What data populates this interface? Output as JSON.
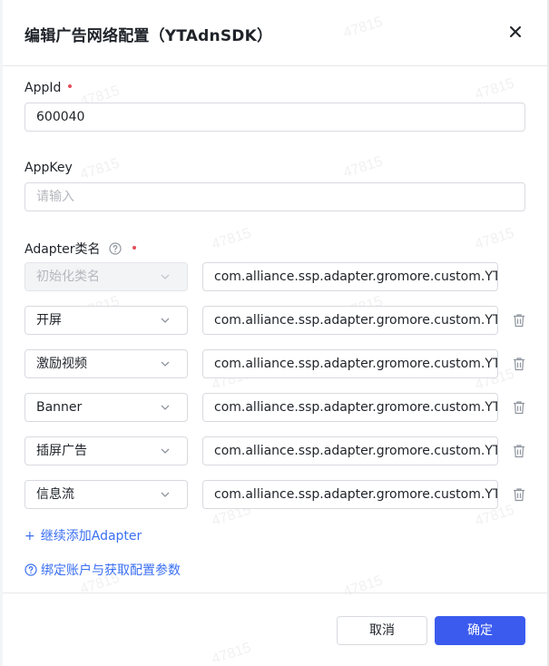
{
  "dialog": {
    "title": "编辑广告网络配置（YTAdnSDK）",
    "close_icon": "close-icon"
  },
  "form": {
    "appid_label": "AppId",
    "appid_value": "600040",
    "appkey_label": "AppKey",
    "appkey_placeholder": "请输入",
    "adapter_label": "Adapter类名",
    "adapters": [
      {
        "type": "初始化类名",
        "class": "com.alliance.ssp.adapter.gromore.custom.YTCustom",
        "disabled": true
      },
      {
        "type": "开屏",
        "class": "com.alliance.ssp.adapter.gromore.custom.YTCust"
      },
      {
        "type": "激励视频",
        "class": "com.alliance.ssp.adapter.gromore.custom.YTCust"
      },
      {
        "type": "Banner",
        "class": "com.alliance.ssp.adapter.gromore.custom.YTCust"
      },
      {
        "type": "插屏广告",
        "class": "com.alliance.ssp.adapter.gromore.custom.YTCust"
      },
      {
        "type": "信息流",
        "class": "com.alliance.ssp.adapter.gromore.custom.YTCust"
      }
    ],
    "add_adapter": "继续添加Adapter",
    "bind_link": "绑定账户与获取配置参数"
  },
  "footer": {
    "cancel": "取消",
    "ok": "确定"
  },
  "watermark": "47815",
  "colors": {
    "primary": "#3b5bef",
    "link": "#3a6ff2",
    "required": "#e34d59"
  }
}
